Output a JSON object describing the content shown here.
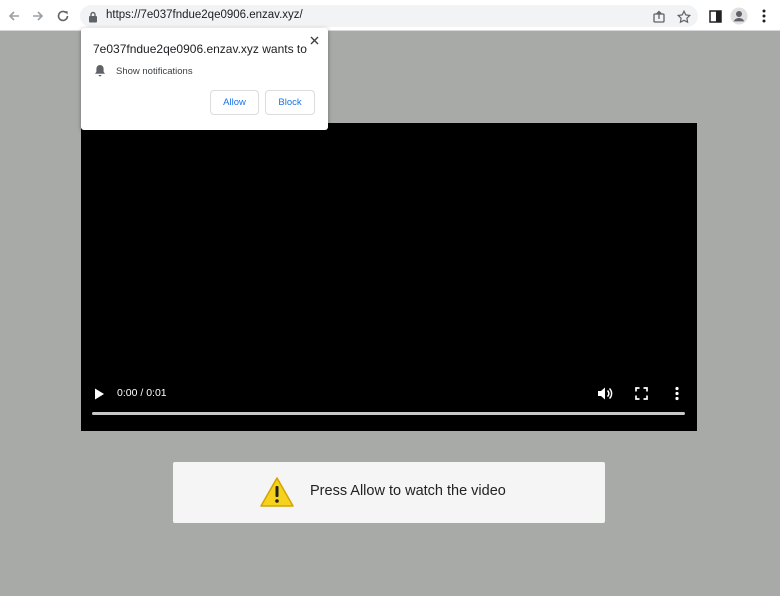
{
  "browser": {
    "url": "https://7e037fndue2qe0906.enzav.xyz/",
    "icons": [
      "back-arrow-icon",
      "forward-arrow-icon",
      "reload-icon",
      "lock-icon",
      "share-icon",
      "star-icon",
      "side-panel-icon",
      "profile-icon",
      "kebab-menu-icon"
    ]
  },
  "notification_prompt": {
    "title": "7e037fndue2qe0906.enzav.xyz wants to",
    "permission": "Show notifications",
    "allow_label": "Allow",
    "block_label": "Block"
  },
  "video": {
    "time": "0:00 / 0:01",
    "progress": 0
  },
  "banner": {
    "text": "Press Allow to watch the video",
    "icon": "warning-icon"
  },
  "colors": {
    "page_background": "#a7aaa6",
    "accent": "#1a73e8",
    "warning_fill": "#f7d21d"
  }
}
